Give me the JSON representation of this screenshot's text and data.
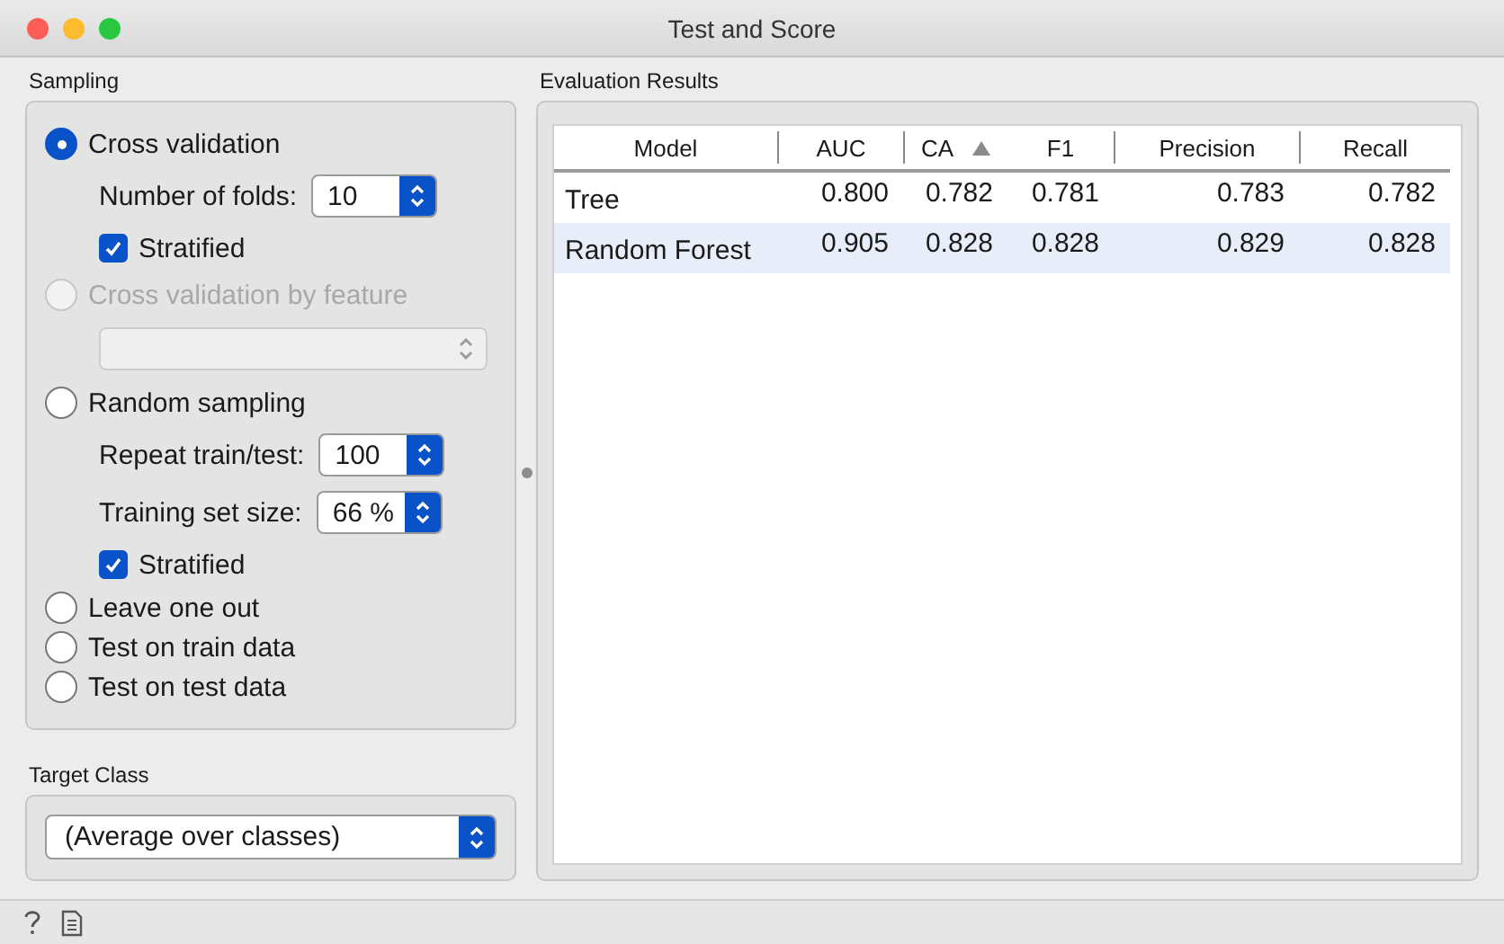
{
  "window": {
    "title": "Test and Score"
  },
  "sampling": {
    "title": "Sampling",
    "options": [
      {
        "label": "Cross validation",
        "selected": true,
        "disabled": false,
        "controls": [
          {
            "kind": "spin",
            "label": "Number of folds:",
            "value": "10"
          },
          {
            "kind": "checkbox",
            "label": "Stratified",
            "checked": true
          }
        ]
      },
      {
        "label": "Cross validation by feature",
        "selected": false,
        "disabled": true,
        "controls": [
          {
            "kind": "combo",
            "disabled": true
          }
        ]
      },
      {
        "label": "Random sampling",
        "selected": false,
        "disabled": false,
        "controls": [
          {
            "kind": "spin",
            "label": "Repeat train/test:",
            "value": "100"
          },
          {
            "kind": "spin",
            "label": "Training set size:",
            "value": "66 %"
          },
          {
            "kind": "checkbox",
            "label": "Stratified",
            "checked": true
          }
        ]
      },
      {
        "label": "Leave one out",
        "selected": false,
        "disabled": false
      },
      {
        "label": "Test on train data",
        "selected": false,
        "disabled": false
      },
      {
        "label": "Test on test data",
        "selected": false,
        "disabled": false
      }
    ]
  },
  "target_class": {
    "title": "Target Class",
    "value": "(Average over classes)"
  },
  "results": {
    "title": "Evaluation Results",
    "columns": [
      {
        "label": "Model",
        "sorted": false
      },
      {
        "label": "AUC",
        "sorted": false
      },
      {
        "label": "CA",
        "sorted": true
      },
      {
        "label": "F1",
        "sorted": false
      },
      {
        "label": "Precision",
        "sorted": false
      },
      {
        "label": "Recall",
        "sorted": false
      }
    ],
    "rows": [
      [
        "Tree",
        "0.800",
        "0.782",
        "0.781",
        "0.783",
        "0.782"
      ],
      [
        "Random Forest",
        "0.905",
        "0.828",
        "0.828",
        "0.829",
        "0.828"
      ]
    ]
  }
}
